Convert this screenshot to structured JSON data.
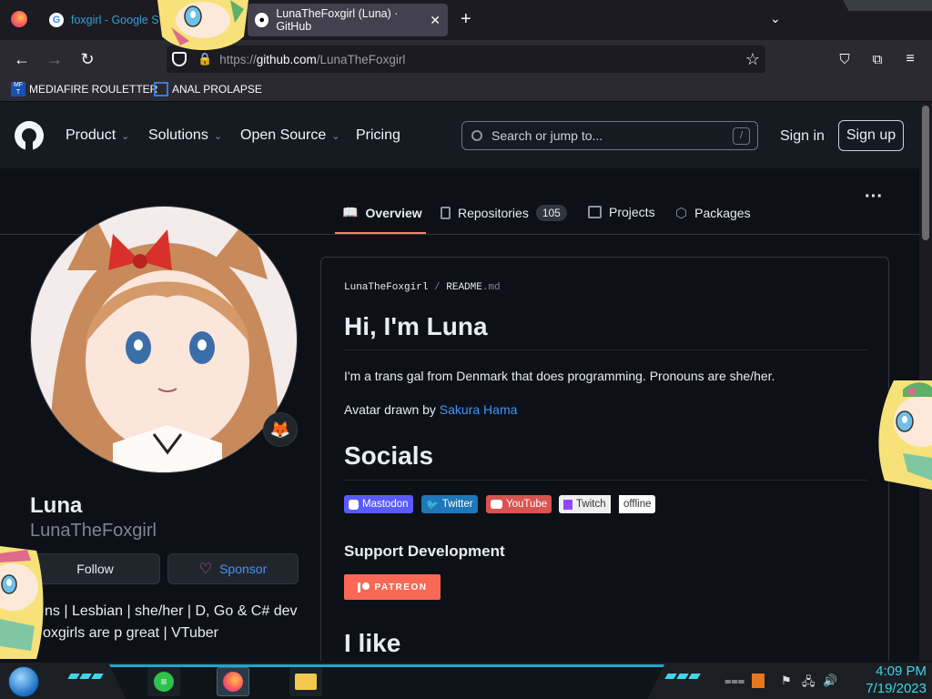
{
  "browser": {
    "tabs": [
      {
        "title": "foxgirl - Google S",
        "favicon": "G",
        "active": false
      },
      {
        "title": "LunaTheFoxgirl (Luna) · GitHub",
        "favicon": "github-icon",
        "active": true
      }
    ],
    "new_tab_symbol": "+",
    "url_prefix": "https://",
    "url_host": "github.com",
    "url_path": "/LunaTheFoxgirl",
    "bookmarks": [
      {
        "label": "MEDIAFIRE ROULETTER",
        "icon": "mediafire-icon"
      },
      {
        "label": "ANAL PROLAPSE",
        "icon": "bookmark-icon"
      }
    ]
  },
  "github": {
    "nav": {
      "product": "Product",
      "solutions": "Solutions",
      "open_source": "Open Source",
      "pricing": "Pricing"
    },
    "search_placeholder": "Search or jump to...",
    "search_shortcut": "/",
    "sign_in": "Sign in",
    "sign_up": "Sign up",
    "tabs": {
      "overview": "Overview",
      "repositories": "Repositories",
      "repositories_count": "105",
      "projects": "Projects",
      "packages": "Packages"
    },
    "more": "···"
  },
  "profile": {
    "name": "Luna",
    "login": "LunaTheFoxgirl",
    "follow": "Follow",
    "sponsor": "Sponsor",
    "bio_line1": "ns | Lesbian | she/her | D, Go & C# dev",
    "bio_line2": "oxgirls are p great | VTuber",
    "status_emoji": "🦊"
  },
  "readme": {
    "path_user": "LunaTheFoxgirl",
    "path_sep": "/",
    "path_file": "README",
    "path_ext": ".md",
    "heading": "Hi, I'm Luna",
    "intro": "I'm a trans gal from Denmark that does programming. Pronouns are she/her.",
    "avatar_credit_prefix": "Avatar drawn by ",
    "avatar_credit_link": "Sakura Hama",
    "socials_heading": "Socials",
    "badges": [
      {
        "label": "Mastodon",
        "color": "#6364ff"
      },
      {
        "label": "Twitter",
        "color": "#1d9bf0"
      },
      {
        "label": "YouTube",
        "color": "#e05d44"
      },
      {
        "label": "Twitch",
        "color": "#ffffff"
      },
      {
        "label": "offline",
        "color": "#ffffff"
      }
    ],
    "support_heading": "Support Development",
    "patreon": "PATREON",
    "like_heading": "I like"
  },
  "taskbar": {
    "time": "4:09 PM",
    "date": "7/19/2023"
  },
  "colors": {
    "accent_underline": "#f78166",
    "link": "#4493f8",
    "clock": "#3ed6e8"
  }
}
